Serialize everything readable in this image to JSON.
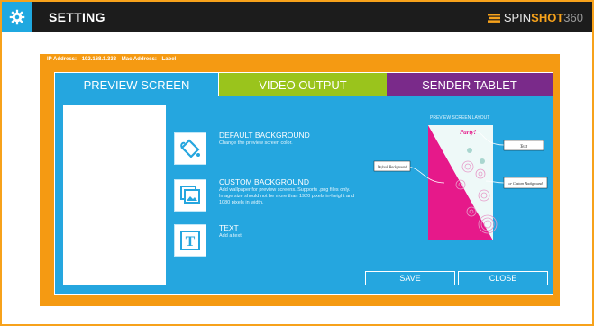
{
  "header": {
    "title": "SETTING",
    "brand": {
      "part1": "SPIN",
      "part2": "SHOT",
      "part3": "360"
    }
  },
  "info": {
    "ip_label": "IP Address:",
    "ip_value": "192.168.1.333",
    "mac_label": "Mac Address:",
    "label_label": "Label"
  },
  "tabs": [
    {
      "label": "PREVIEW SCREEN",
      "color": "#25a6df"
    },
    {
      "label": "VIDEO OUTPUT",
      "color": "#9ac41c"
    },
    {
      "label": "SENDER TABLET",
      "color": "#7a2a8a"
    }
  ],
  "options": {
    "default_bg": {
      "title": "DEFAULT BACKGROUND",
      "desc": "Change the preview screen color.",
      "icon": "paint-bucket-icon"
    },
    "custom_bg": {
      "title": "CUSTOM BACKGROUND",
      "desc": "Add wallpaper for preview screens. Supports .png files only. Image size should not be more than 1920 pixels in-height and 1080 pixels in width.",
      "icon": "image-stack-icon"
    },
    "text": {
      "title": "TEXT",
      "desc": "Add a text.",
      "icon": "text-t-icon"
    }
  },
  "layout": {
    "label": "PREVIEW SCREEN LAYOUT",
    "party_text": "Party!",
    "callout_text": "Text",
    "callout_default": "Default Background",
    "callout_custom": "or Custom Background"
  },
  "buttons": {
    "save": "SAVE",
    "close": "CLOSE"
  },
  "colors": {
    "accent": "#f59a12",
    "panel": "#25a6df",
    "header": "#1c1c1c",
    "magenta": "#e6198a"
  }
}
